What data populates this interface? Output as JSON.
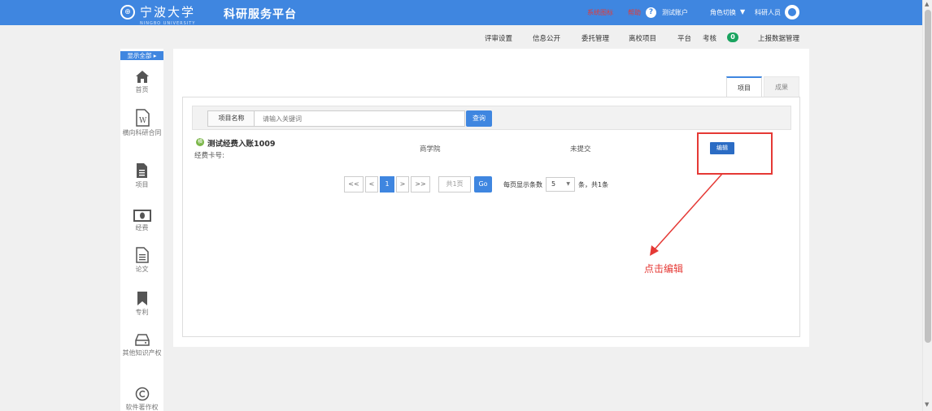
{
  "header": {
    "university_name": "宁波大学",
    "university_sub": "NINGBO UNIVERSITY",
    "platform_title": "科研服务平台",
    "system_notice": "系统图标",
    "help": "帮助",
    "help_icon": "?",
    "user": "测试账户",
    "role_switch": "角色切换",
    "role_caret": "▼",
    "role": "科研人员"
  },
  "nav": {
    "items": [
      "评审设置",
      "信息公开",
      "委托管理",
      "离校项目",
      "平台",
      "考核"
    ],
    "badge": "0",
    "last": "上报数据管理"
  },
  "sidebar": {
    "show_all": "显示全部 ▸",
    "items": [
      {
        "label": "首页",
        "icon": "home-icon"
      },
      {
        "label": "横向科研合同",
        "icon": "word-document-icon"
      },
      {
        "label": "项目",
        "icon": "document-icon"
      },
      {
        "label": "经费",
        "icon": "money-icon"
      },
      {
        "label": "论文",
        "icon": "paper-icon"
      },
      {
        "label": "专利",
        "icon": "bookmark-icon"
      },
      {
        "label": "其他知识产权",
        "icon": "hard-drive-icon"
      },
      {
        "label": "软件著作权",
        "icon": "copyright-icon"
      }
    ]
  },
  "tabs": [
    "项目",
    "成果"
  ],
  "search": {
    "label": "项目名称",
    "placeholder": "请输入关键词",
    "button": "查询"
  },
  "project": {
    "badge": "横",
    "name": "测试经费入账1009",
    "fund_card_label": "经费卡号:",
    "department": "商学院",
    "status": "未提交",
    "edit_label": "编辑"
  },
  "pagination": {
    "first": "<<",
    "prev": "<",
    "current": "1",
    "next": ">",
    "last": ">>",
    "total_pages": "共1页",
    "go": "Go",
    "page_size_label": "每页显示条数",
    "page_size": "5",
    "page_size_caret": "▼",
    "tail": "条，共1条"
  },
  "annotation": {
    "text": "点击编辑",
    "color": "#e53935"
  },
  "colors": {
    "header_blue": "#3f86e0",
    "annotation_red": "#e53935",
    "badge_green": "#1aa35f"
  }
}
